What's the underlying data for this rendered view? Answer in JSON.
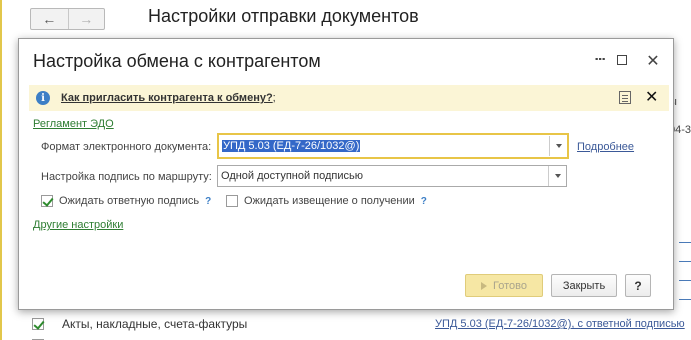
{
  "background": {
    "title": "Настройки отправки документов",
    "nav": {
      "back": "←",
      "forward": "→"
    },
    "right_text_1": "ы",
    "right_text_2": "04-3",
    "row": {
      "label": "Акты, накладные, счета-фактуры",
      "link": "УПД 5.03 (ЕД-7-26/1032@), с ответной подписью",
      "checked": true
    }
  },
  "dialog": {
    "title": "Настройка обмена с контрагентом",
    "controls": {
      "more": "⋮",
      "close": "✕"
    },
    "info": {
      "icon": "i",
      "link": "Как пригласить контрагента к обмену?",
      "tail": ";",
      "close": "✕"
    },
    "edo_link": "Регламент ЭДО",
    "format": {
      "label": "Формат электронного документа:",
      "value": "УПД 5.03 (ЕД-7-26/1032@)",
      "more_link": "Подробнее"
    },
    "signature": {
      "label": "Настройка подпись по маршруту:",
      "value": "Одной доступной подписью"
    },
    "checks": [
      {
        "label": "Ожидать ответную подпись",
        "checked": true,
        "help": "?"
      },
      {
        "label": "Ожидать извещение о получении",
        "checked": false,
        "help": "?"
      }
    ],
    "other_settings": "Другие настройки",
    "buttons": {
      "done": "Готово",
      "close": "Закрыть",
      "help": "?"
    }
  }
}
